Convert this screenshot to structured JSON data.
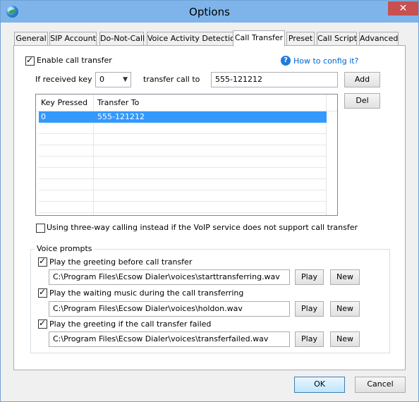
{
  "window": {
    "title": "Options",
    "close_glyph": "✕",
    "app_icon": "globe-icon"
  },
  "tabs": [
    {
      "label": "General"
    },
    {
      "label": "SIP Account"
    },
    {
      "label": "Do-Not-Call"
    },
    {
      "label": "Voice Activity Detection"
    },
    {
      "label": "Call Transfer",
      "active": true
    },
    {
      "label": "Preset"
    },
    {
      "label": "Call Script"
    },
    {
      "label": "Advanced"
    }
  ],
  "transfer": {
    "enable_label": "Enable call transfer",
    "enable_checked": true,
    "help_glyph": "?",
    "help_link": "How to config it?",
    "received_key_label": "If received key",
    "received_key_value": "0",
    "transfer_to_label": "transfer call to",
    "transfer_to_value": "555-121212",
    "add_label": "Add",
    "del_label": "Del",
    "columns": [
      "Key Pressed",
      "Transfer To"
    ],
    "rows": [
      {
        "key": "0",
        "to": "555-121212"
      }
    ],
    "three_way_label": "Using three-way calling instead if the VoIP service does not support call transfer",
    "three_way_checked": false
  },
  "voice_prompts": {
    "group_label": "Voice prompts",
    "items": [
      {
        "label": "Play the greeting before call transfer",
        "checked": true,
        "path": "C:\\Program Files\\Ecsow Dialer\\voices\\starttransferring.wav"
      },
      {
        "label": "Play the waiting music during the call transferring",
        "checked": true,
        "path": "C:\\Program Files\\Ecsow Dialer\\voices\\holdon.wav"
      },
      {
        "label": "Play the greeting if the call transfer failed",
        "checked": true,
        "path": "C:\\Program Files\\Ecsow Dialer\\voices\\transferfailed.wav"
      }
    ],
    "play_label": "Play",
    "new_label": "New"
  },
  "footer": {
    "ok_label": "OK",
    "cancel_label": "Cancel"
  },
  "colors": {
    "titlebar": "#7eb4ea",
    "selection": "#3399ff",
    "close": "#c75050",
    "link": "#0066cc"
  }
}
